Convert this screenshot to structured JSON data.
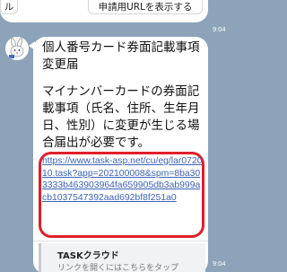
{
  "top": {
    "left_button_label": "ル",
    "right_button_label": "申請用URLを表示する",
    "time": "9:04"
  },
  "message": {
    "title": "個人番号カード券面記載事項変更届",
    "description": "マイナンバーカードの券面記載事項（氏名、住所、生年月日、性別）に変更が生じる場合届出が必要です。",
    "url": "https://www.task-asp.net/cu/eg/lar072010.task?app=202100008&spm=8ba303333b463903964fa659905db3ab999acb1037547392aad692bf8f251a0",
    "link_preview": {
      "name": "TASKクラウド",
      "subtitle": "リンクを開くにはこちらをタップ"
    },
    "time": "9:04"
  },
  "colors": {
    "background": "#8ca3b9",
    "link": "#3d62b6",
    "highlight_border": "#e01f2a"
  },
  "icons": {
    "avatar": "rabbit-mascot-icon"
  }
}
